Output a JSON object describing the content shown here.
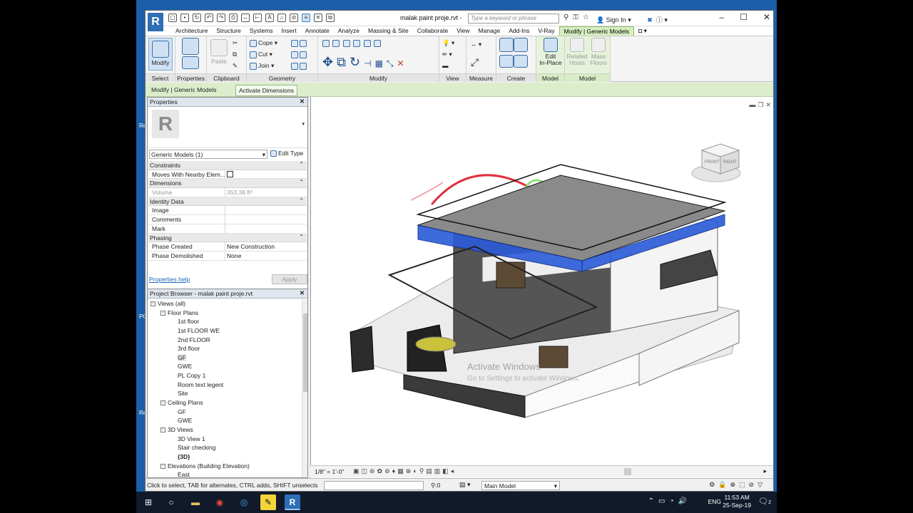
{
  "app": {
    "logo": "R",
    "document_title": "malak paint proje.rvt -",
    "search_placeholder": "Type a keyword or phrase",
    "signin": "Sign In"
  },
  "ribbon_tabs": [
    "Architecture",
    "Structure",
    "Systems",
    "Insert",
    "Annotate",
    "Analyze",
    "Massing & Site",
    "Collaborate",
    "View",
    "Manage",
    "Add-Ins",
    "V-Ray",
    "Modify | Generic Models"
  ],
  "ribbon": {
    "modify": "Modify",
    "paste": "Paste",
    "cope": "Cope",
    "cut": "Cut",
    "join": "Join",
    "edit_inplace": "Edit\nIn-Place",
    "related_hosts": "Related\nHosts",
    "mass_floors": "Mass\nFloors",
    "panels": [
      "Select",
      "Properties",
      "Clipboard",
      "Geometry",
      "Modify",
      "View",
      "Measure",
      "Create",
      "Model",
      "Model"
    ]
  },
  "context": {
    "title": "Modify | Generic Models",
    "activate": "Activate Dimensions"
  },
  "properties": {
    "header": "Properties",
    "type_logo": "R",
    "selector": "Generic Models (1)",
    "edit_type": "Edit Type",
    "groups": [
      {
        "name": "Constraints",
        "rows": [
          {
            "k": "Moves With Nearby Elem...",
            "v": "",
            "checkbox": true
          }
        ]
      },
      {
        "name": "Dimensions",
        "rows": [
          {
            "k": "Volume",
            "v": "353.38 ft³",
            "ro": true
          }
        ]
      },
      {
        "name": "Identity Data",
        "rows": [
          {
            "k": "Image",
            "v": ""
          },
          {
            "k": "Comments",
            "v": ""
          },
          {
            "k": "Mark",
            "v": ""
          }
        ]
      },
      {
        "name": "Phasing",
        "rows": [
          {
            "k": "Phase Created",
            "v": "New Construction"
          },
          {
            "k": "Phase Demolished",
            "v": "None"
          }
        ]
      }
    ],
    "help": "Properties help",
    "apply": "Apply"
  },
  "browser": {
    "header": "Project Browser - malak paint proje.rvt",
    "items": [
      {
        "t": "Views (all)",
        "lvl": 0,
        "tg": "-"
      },
      {
        "t": "Floor Plans",
        "lvl": 1,
        "tg": "-"
      },
      {
        "t": "1st floor",
        "lvl": 2
      },
      {
        "t": "1st FLOOR WE",
        "lvl": 2
      },
      {
        "t": "2nd FLOOR",
        "lvl": 2
      },
      {
        "t": "3rd floor",
        "lvl": 2
      },
      {
        "t": "GF",
        "lvl": 2,
        "sel": true
      },
      {
        "t": "GWE",
        "lvl": 2
      },
      {
        "t": "PL Copy 1",
        "lvl": 2
      },
      {
        "t": "Room text legent",
        "lvl": 2
      },
      {
        "t": "Site",
        "lvl": 2
      },
      {
        "t": "Ceiling Plans",
        "lvl": 1,
        "tg": "-"
      },
      {
        "t": "GF",
        "lvl": 2
      },
      {
        "t": "GWE",
        "lvl": 2
      },
      {
        "t": "3D Views",
        "lvl": 1,
        "tg": "-"
      },
      {
        "t": "3D View 1",
        "lvl": 2
      },
      {
        "t": "Stair checking",
        "lvl": 2
      },
      {
        "t": "{3D}",
        "lvl": 2,
        "bold": true
      },
      {
        "t": "Elevations (Building Elevation)",
        "lvl": 1,
        "tg": "-"
      },
      {
        "t": "East",
        "lvl": 2
      }
    ]
  },
  "view": {
    "scale": "1/8\" = 1'-0\"",
    "cube_front": "FRONT",
    "cube_right": "RIGHT"
  },
  "watermark": {
    "line1": "Activate Windows",
    "line2": "Go to Settings to activate Windows."
  },
  "status": {
    "text": "Click to select, TAB for alternates, CTRL adds, SHIFT unselects",
    "zero": ":0",
    "model": "Main Model"
  },
  "taskbar": {
    "lang": "ENG",
    "time": "11:53 AM",
    "date": "25-Sep-19",
    "notif": "2"
  },
  "colors": {
    "accent": "#2e6eb5",
    "context_green": "#d6efc1",
    "selection_blue": "#1f4fd6"
  }
}
